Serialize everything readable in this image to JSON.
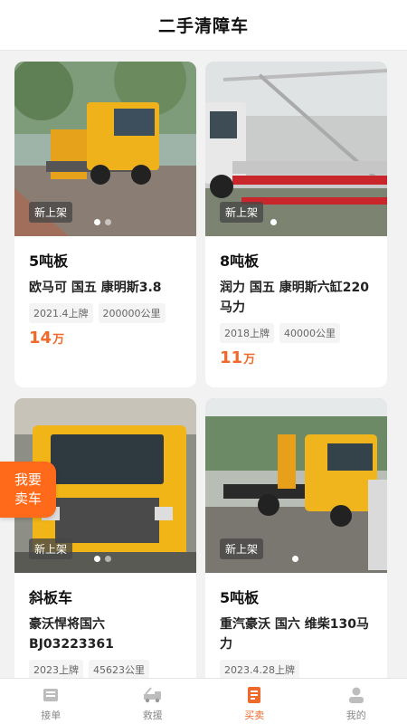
{
  "header": {
    "title": "二手清障车"
  },
  "cards": [
    {
      "tag": "新上架",
      "category": "5吨板",
      "name": "欧马可 国五 康明斯3.8",
      "chips": [
        "2021.4上牌",
        "200000公里"
      ],
      "price": "14",
      "unit": "万"
    },
    {
      "tag": "新上架",
      "category": "8吨板",
      "name": "润力 国五 康明斯六缸220马力",
      "chips": [
        "2018上牌",
        "40000公里"
      ],
      "price": "11",
      "unit": "万"
    },
    {
      "tag": "新上架",
      "category": "斜板车",
      "name": "豪沃悍将国六BJ03223361",
      "chips": [
        "2023上牌",
        "45623公里"
      ],
      "price": "",
      "unit": ""
    },
    {
      "tag": "新上架",
      "category": "5吨板",
      "name": "重汽豪沃 国六 维柴130马力",
      "chips": [
        "2023.4.28上牌"
      ],
      "price": "",
      "unit": ""
    }
  ],
  "sell_button": {
    "line1": "我要",
    "line2": "卖车"
  },
  "tabs": [
    {
      "label": "接单",
      "icon": "order-icon",
      "active": false
    },
    {
      "label": "救援",
      "icon": "rescue-truck-icon",
      "active": false
    },
    {
      "label": "买卖",
      "icon": "trade-icon",
      "active": true
    },
    {
      "label": "我的",
      "icon": "profile-icon",
      "active": false
    }
  ],
  "colors": {
    "accent": "#ef6a2a",
    "sell": "#ff6a1a"
  }
}
